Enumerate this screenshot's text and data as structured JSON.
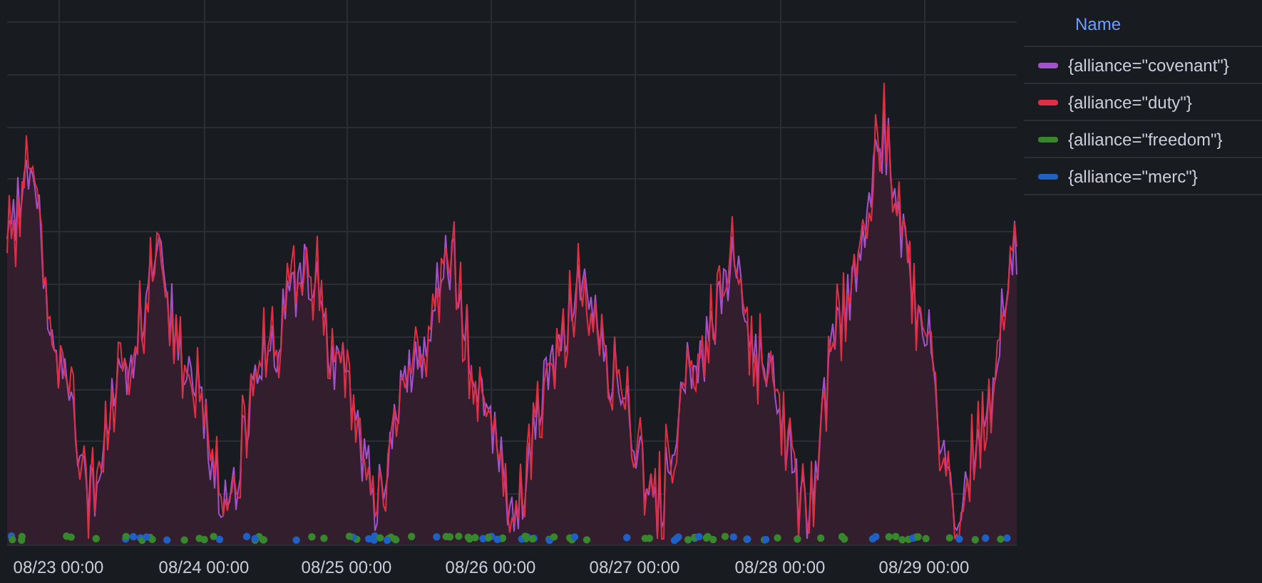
{
  "legend": {
    "header": "Name",
    "items": [
      {
        "label": "{alliance=\"covenant\"}",
        "color": "#a352cc"
      },
      {
        "label": "{alliance=\"duty\"}",
        "color": "#e02f44"
      },
      {
        "label": "{alliance=\"freedom\"}",
        "color": "#37872d"
      },
      {
        "label": "{alliance=\"merc\"}",
        "color": "#1f60c4"
      }
    ]
  },
  "x_axis": {
    "ticks": [
      "08/23 00:00",
      "08/24 00:00",
      "08/25 00:00",
      "08/26 00:00",
      "08/27 00:00",
      "08/28 00:00",
      "08/29 00:00"
    ]
  }
}
